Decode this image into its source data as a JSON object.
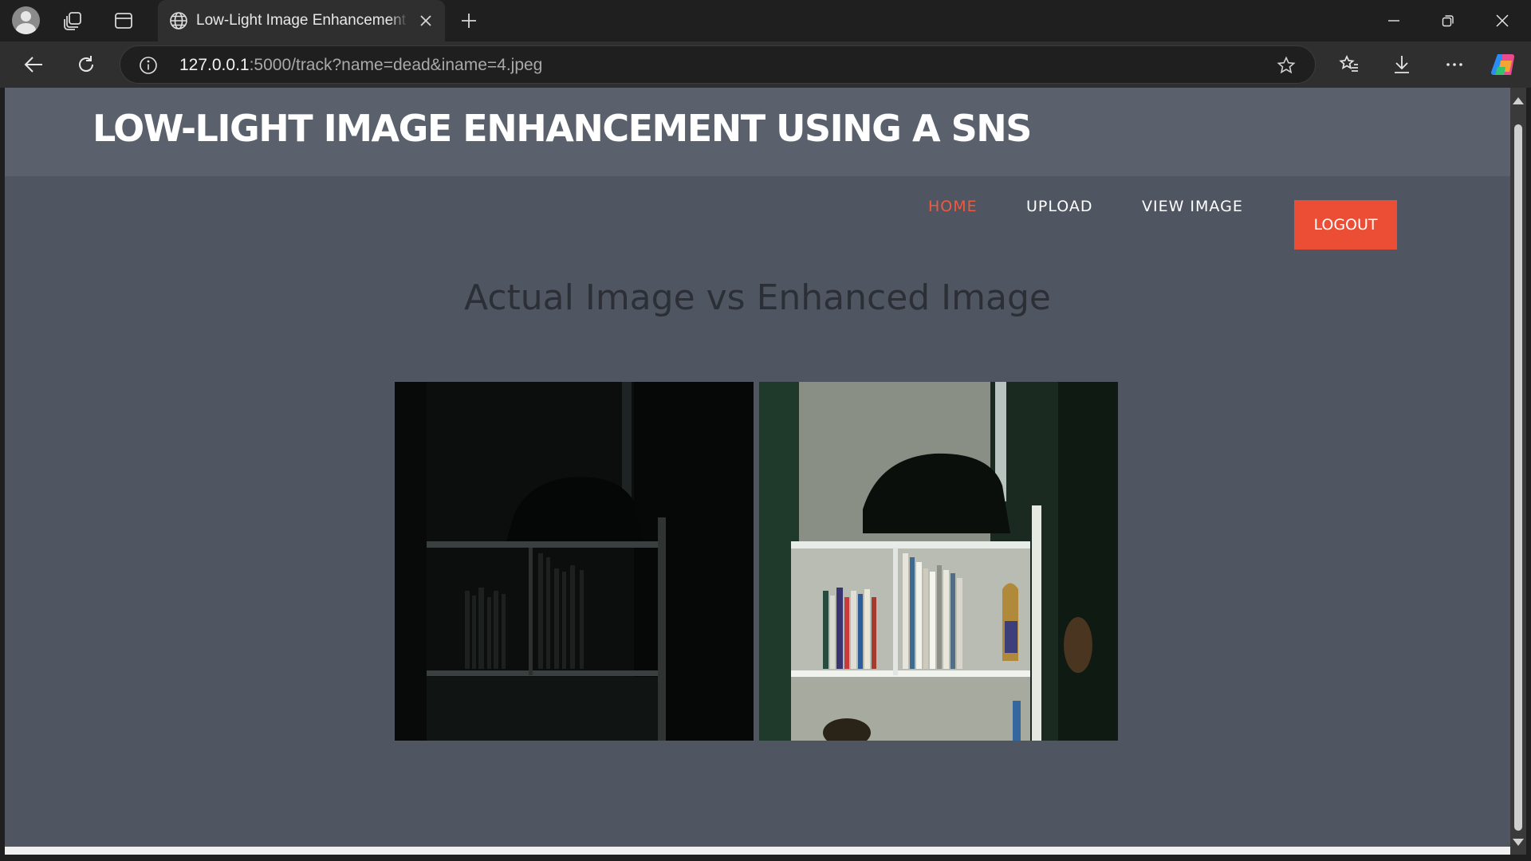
{
  "browser": {
    "tab_title": "Low-Light Image Enhancement Using",
    "url_host": "127.0.0.1",
    "url_rest": ":5000/track?name=dead&iname=4.jpeg",
    "icons": [
      "profile-icon",
      "workspaces-icon",
      "tab-actions-icon",
      "globe-icon",
      "close-tab-icon",
      "new-tab-icon",
      "minimize-icon",
      "restore-icon",
      "close-window-icon",
      "back-icon",
      "refresh-icon",
      "site-info-icon",
      "favorite-star-icon",
      "favorites-icon",
      "downloads-icon",
      "more-icon",
      "copilot-icon"
    ]
  },
  "page": {
    "site_title": "LOW-LIGHT IMAGE ENHANCEMENT USING A SNS",
    "nav": {
      "home": "HOME",
      "upload": "UPLOAD",
      "view_image": "VIEW IMAGE",
      "logout": "LOGOUT"
    },
    "heading": "Actual Image vs Enhanced Image",
    "colors": {
      "header_bg": "#5a616c",
      "body_bg": "#4f5662",
      "accent": "#ec4e35",
      "active_link": "#ef5940"
    }
  }
}
